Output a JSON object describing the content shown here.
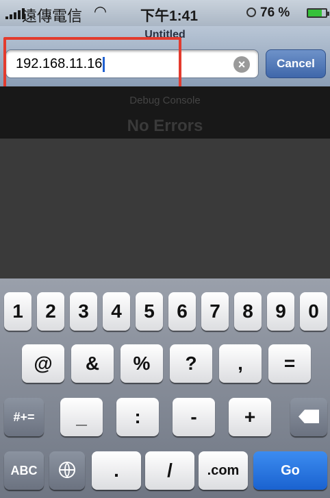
{
  "status_bar": {
    "carrier": "遠傳電信",
    "time": "下午1:41",
    "battery_percent": "76 %",
    "battery_level": 0.76
  },
  "address_bar": {
    "page_title": "Untitled",
    "url_value": "192.168.11.16",
    "clear_label": "×",
    "cancel_label": "Cancel"
  },
  "console": {
    "title": "Debug Console",
    "status": "No Errors"
  },
  "keyboard": {
    "row1": [
      "1",
      "2",
      "3",
      "4",
      "5",
      "6",
      "7",
      "8",
      "9",
      "0"
    ],
    "row2": [
      "@",
      "&",
      "%",
      "?",
      ",",
      "="
    ],
    "row3": [
      "_",
      ":",
      "-",
      "+"
    ],
    "symbols_label": "#+=",
    "abc_label": "ABC",
    "dot_label": ".",
    "slash_label": "/",
    "com_label": ".com",
    "go_label": "Go"
  },
  "colors": {
    "highlight": "#e33b2e",
    "go_key": "#1a62d0",
    "cancel_button": "#3f67aa"
  }
}
